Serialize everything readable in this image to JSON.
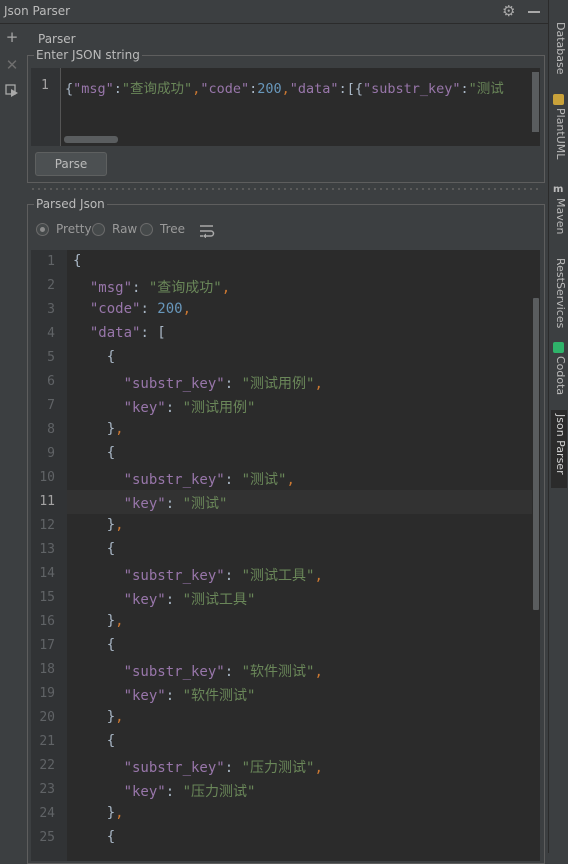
{
  "window": {
    "title": "Json Parser"
  },
  "tabs": {
    "parser_label": "Parser"
  },
  "right_sidebar": {
    "tabs": [
      "Database",
      "PlantUML",
      "Maven",
      "RestServices",
      "Codota",
      "Json Parser"
    ],
    "active": "Json Parser"
  },
  "input": {
    "group_label": "Enter JSON string",
    "line_number": "1",
    "text": "{\"msg\":\"查询成功\",\"code\":200,\"data\":[{\"substr_key\":\"测试"
  },
  "parse_button": {
    "label": "Parse"
  },
  "output": {
    "group_label": "Parsed Json",
    "modes": [
      {
        "label": "Pretty",
        "selected": true
      },
      {
        "label": "Raw",
        "selected": false
      },
      {
        "label": "Tree",
        "selected": false
      }
    ],
    "current_line": 11,
    "lines": [
      "{",
      "\"msg\": \"查询成功\",",
      "\"code\": 200,",
      "\"data\": [",
      "{",
      "\"substr_key\": \"测试用例\",",
      "\"key\": \"测试用例\"",
      "},",
      "{",
      "\"substr_key\": \"测试\",",
      "\"key\": \"测试\"",
      "},",
      "{",
      "\"substr_key\": \"测试工具\",",
      "\"key\": \"测试工具\"",
      "},",
      "{",
      "\"substr_key\": \"软件测试\",",
      "\"key\": \"软件测试\"",
      "},",
      "{",
      "\"substr_key\": \"压力测试\",",
      "\"key\": \"压力测试\"",
      "},",
      "{"
    ]
  },
  "colors": {
    "key": "#9876aa",
    "string": "#6a8759",
    "number": "#6897bb",
    "punct": "#cc7832",
    "editor_bg": "#2b2b2b",
    "panel_bg": "#3c3f41"
  },
  "icons": [
    "gear-icon",
    "minimize-icon",
    "add-icon",
    "close-icon",
    "run-icon",
    "soft-wrap-icon"
  ]
}
